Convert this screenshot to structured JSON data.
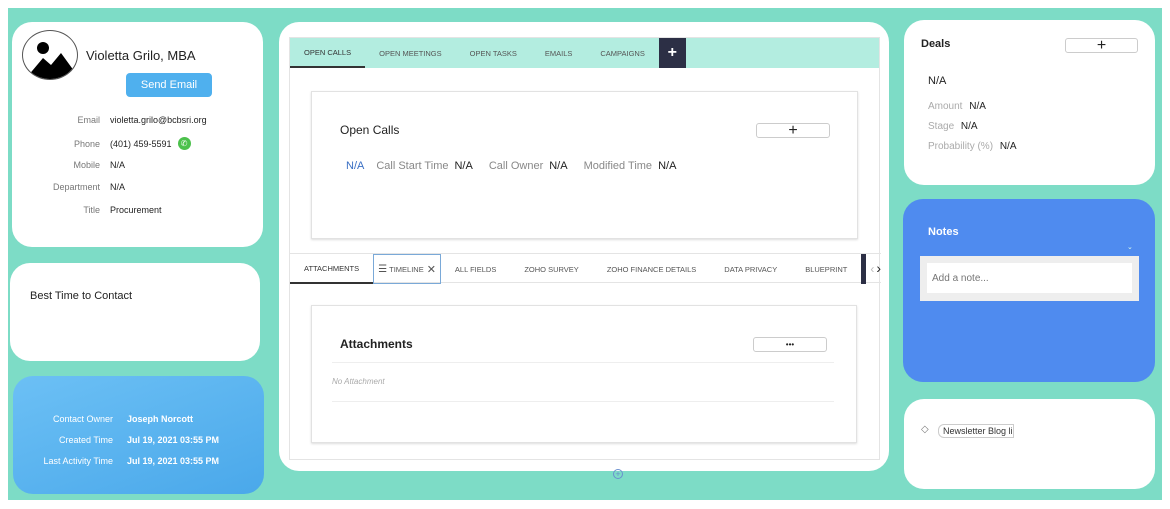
{
  "contact": {
    "name": "Violetta Grilo, MBA",
    "send_email": "Send Email",
    "fields": [
      {
        "label": "Email",
        "value": "violetta.grilo@bcbsri.org"
      },
      {
        "label": "Phone",
        "value": "(401) 459-5591"
      },
      {
        "label": "Mobile",
        "value": "N/A"
      },
      {
        "label": "Department",
        "value": "N/A"
      },
      {
        "label": "Title",
        "value": "Procurement"
      }
    ]
  },
  "best_time": {
    "title": "Best Time to Contact"
  },
  "meta": [
    {
      "label": "Contact Owner",
      "value": "Joseph Norcott"
    },
    {
      "label": "Created Time",
      "value": "Jul 19, 2021 03:55 PM"
    },
    {
      "label": "Last Activity Time",
      "value": "Jul 19, 2021 03:55 PM"
    }
  ],
  "top_tabs": [
    "OPEN CALLS",
    "OPEN MEETINGS",
    "OPEN TASKS",
    "EMAILS",
    "CAMPAIGNS"
  ],
  "open_calls": {
    "title": "Open Calls",
    "subject": "N/A",
    "fields": [
      {
        "label": "Call Start Time",
        "value": "N/A"
      },
      {
        "label": "Call Owner",
        "value": "N/A"
      },
      {
        "label": "Modified Time",
        "value": "N/A"
      }
    ]
  },
  "bottom_tabs": [
    "ATTACHMENTS",
    "TIMELINE",
    "ALL FIELDS",
    "ZOHO SURVEY",
    "ZOHO FINANCE DETAILS",
    "DATA PRIVACY",
    "BLUEPRINT"
  ],
  "attachments": {
    "title": "Attachments",
    "more": "•••",
    "empty": "No Attachment"
  },
  "deals": {
    "title": "Deals",
    "name": "N/A",
    "fields": [
      {
        "label": "Amount",
        "value": "N/A"
      },
      {
        "label": "Stage",
        "value": "N/A"
      },
      {
        "label": "Probability (%)",
        "value": "N/A"
      }
    ]
  },
  "notes": {
    "title": "Notes",
    "placeholder": "Add a note..."
  },
  "tags": [
    "Newsletter Blog li"
  ],
  "colors": {
    "bg": "#7ddcc6",
    "tabbar": "#b3ede0",
    "notes": "#4f8bef",
    "send": "#4fb0ee"
  }
}
